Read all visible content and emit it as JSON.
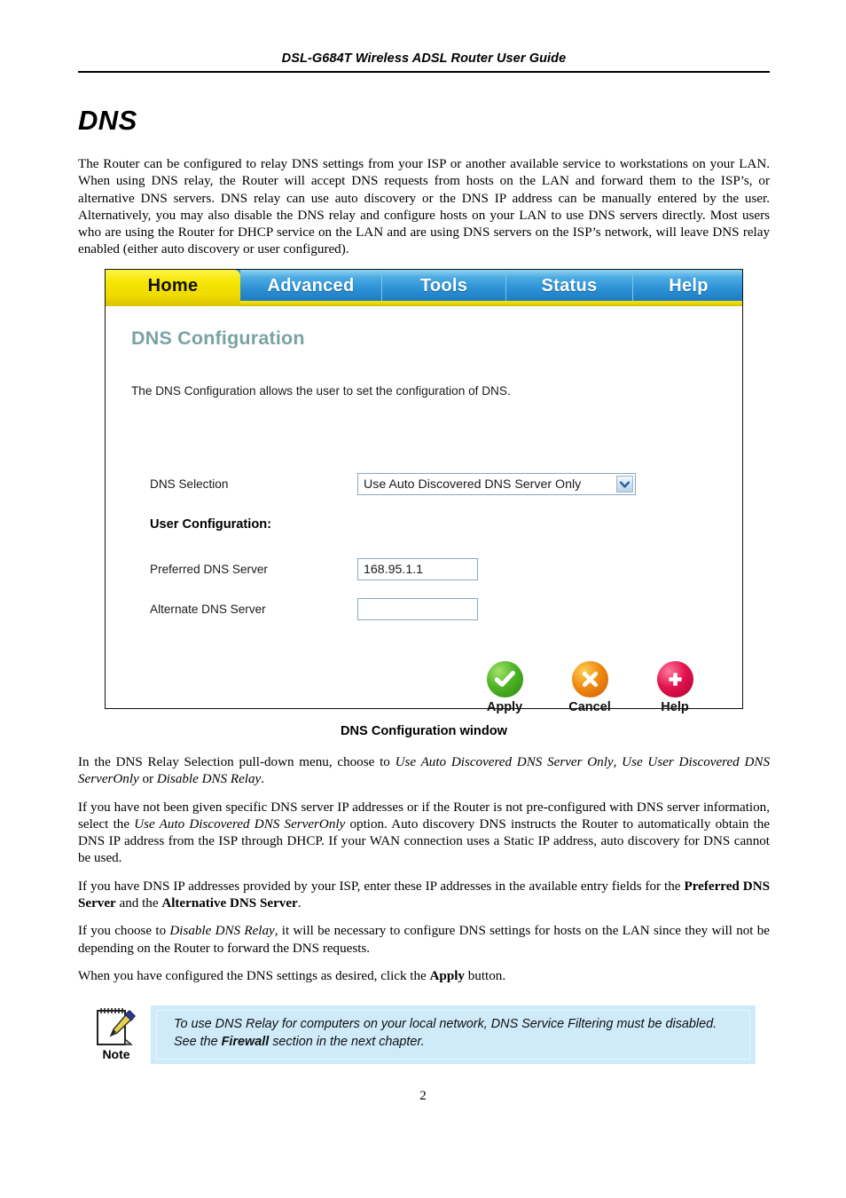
{
  "document": {
    "running_header": "DSL-G684T Wireless ADSL Router User Guide",
    "section_title": "DNS",
    "page_number": "2",
    "figure_caption": "DNS Configuration window"
  },
  "paragraphs": {
    "intro": "The Router can be configured to relay DNS settings from your ISP or another available service to workstations on your LAN. When using DNS relay, the Router will accept DNS requests from hosts on the LAN and forward them to the ISP’s, or alternative DNS servers. DNS relay can use auto discovery or the DNS IP address can be manually entered by the user. Alternatively, you may also disable the DNS relay and configure hosts on your LAN to use DNS servers directly. Most users who are using the Router for DHCP service on the LAN and are using DNS servers on the ISP’s network, will leave DNS relay enabled (either auto discovery or user configured).",
    "p2_a": "In the DNS Relay Selection pull-down menu, choose to ",
    "p2_opt1": "Use Auto Discovered DNS Server Only",
    "p2_b": ", ",
    "p2_opt2": "Use User Discovered DNS ServerOnly",
    "p2_c": " or ",
    "p2_opt3": "Disable DNS Relay",
    "p2_d": ".",
    "p3_a": "If you have not been given specific DNS server IP addresses or if the Router is not pre-configured with DNS server information, select the ",
    "p3_opt": "Use Auto Discovered DNS ServerOnly",
    "p3_b": " option. Auto discovery DNS instructs the Router to automatically obtain the DNS IP address from the ISP through DHCP. If your WAN connection uses a Static IP address, auto discovery for DNS cannot be used.",
    "p4_a": "If you have DNS IP addresses provided by your ISP, enter these IP addresses in the available entry fields for the ",
    "p4_b1": "Preferred DNS Server",
    "p4_b": " and the ",
    "p4_b2": "Alternative DNS Server",
    "p4_c": ".",
    "p5_a": "If you choose to ",
    "p5_i": "Disable DNS Relay",
    "p5_b": ", it will be necessary to configure DNS settings for hosts on the LAN since they will not be depending on the Router to forward the DNS requests.",
    "p6_a": "When you have configured the DNS settings as desired, click the ",
    "p6_b": "Apply",
    "p6_c": " button."
  },
  "router_ui": {
    "tabs": [
      {
        "label": "Home",
        "active": true
      },
      {
        "label": "Advanced",
        "active": false
      },
      {
        "label": "Tools",
        "active": false
      },
      {
        "label": "Status",
        "active": false
      },
      {
        "label": "Help",
        "active": false
      }
    ],
    "panel": {
      "title": "DNS Configuration",
      "description": "The DNS Configuration allows the user to set the configuration of DNS.",
      "dns_selection_label": "DNS Selection",
      "dns_selection_value": "Use Auto Discovered DNS Server Only",
      "user_configuration_label": "User Configuration:",
      "preferred_label": "Preferred DNS Server",
      "preferred_value": "168.95.1.1",
      "alternate_label": "Alternate DNS Server",
      "alternate_value": ""
    },
    "buttons": [
      {
        "label": "Apply",
        "icon": "check-circle-icon",
        "color": "#4fb326"
      },
      {
        "label": "Cancel",
        "icon": "x-circle-icon",
        "color": "#f08a10"
      },
      {
        "label": "Help",
        "icon": "plus-circle-icon",
        "color": "#e2144f"
      }
    ],
    "colors": {
      "active_tab": "#f5e500",
      "idle_tab": "#2a8fd4",
      "panel_title": "#78a3a3",
      "field_border": "#8aa8c4"
    }
  },
  "note": {
    "icon_label": "Note",
    "text_a": "To use DNS Relay for computers on your local network, DNS Service Filtering must be disabled. See the ",
    "text_b": "Firewall",
    "text_c": " section in the next chapter.",
    "background": "#cfeaf9"
  }
}
